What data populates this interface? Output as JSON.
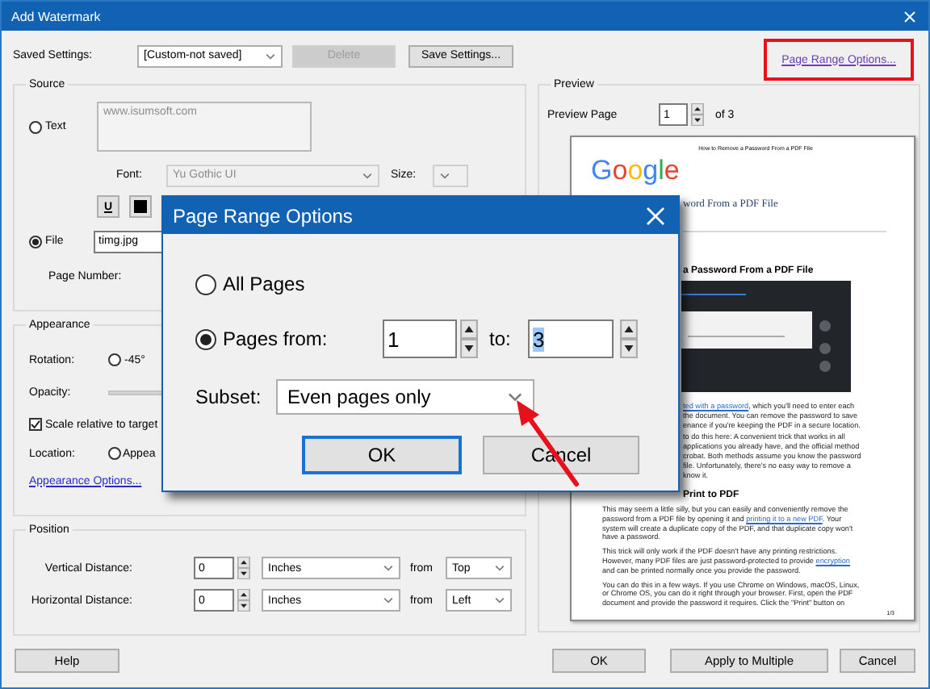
{
  "window": {
    "title": "Add Watermark"
  },
  "saved_settings": {
    "label": "Saved Settings:",
    "value": "[Custom-not saved]",
    "delete_button": {
      "label": "Delete",
      "disabled": true
    },
    "save_button": "Save Settings..."
  },
  "page_range_link": "Page Range Options...",
  "source": {
    "title": "Source",
    "options": [
      {
        "kind": "text",
        "label": "Text",
        "selected": false,
        "value": "www.isumsoft.com"
      },
      {
        "kind": "file",
        "label": "File",
        "selected": true,
        "value": "timg.jpg"
      }
    ],
    "font_label": "Font:",
    "font_value": "Yu Gothic UI",
    "font_disabled": true,
    "size_label": "Size:",
    "underline_button": "U",
    "page_number_label": "Page Number:"
  },
  "appearance": {
    "title": "Appearance",
    "rotation_label": "Rotation:",
    "rotation_option": {
      "label": "-45°",
      "selected": false
    },
    "opacity_label": "Opacity:",
    "scale_checkbox": {
      "label": "Scale relative to target",
      "checked": true
    },
    "location_label": "Location:",
    "location_option": {
      "label": "Appea",
      "selected": false
    },
    "options_link": "Appearance Options..."
  },
  "position": {
    "title": "Position",
    "rows": [
      {
        "label": "Vertical Distance:",
        "value": "0",
        "unit": "Inches",
        "from_label": "from",
        "from": "Top"
      },
      {
        "label": "Horizontal Distance:",
        "value": "0",
        "unit": "Inches",
        "from_label": "from",
        "from": "Left"
      }
    ]
  },
  "preview": {
    "title": "Preview",
    "page_label": "Preview Page",
    "page_value": "1",
    "page_count": "of 3",
    "document": {
      "running_title": "How to Remove a Password From a PDF File",
      "logo": "Google",
      "article_title": "word From a PDF File",
      "section_heading": "a Password From a PDF File",
      "beside_paragraphs": [
        [
          [
            {
              "text": "ted with a password",
              "link": true
            },
            {
              "text": ", which you'll need to enter each",
              "link": false
            }
          ],
          [
            {
              "text": "the document. You can remove the password to save",
              "link": false
            }
          ],
          [
            {
              "text": "enance if you're keeping the PDF in a secure location.",
              "link": false
            }
          ]
        ],
        [
          [
            {
              "text": "to do this here: A convenient trick that works in all",
              "link": false
            }
          ],
          [
            {
              "text": "applications you already have, and the official method",
              "link": false
            }
          ],
          [
            {
              "text": "crobat. Both methods assume you know the password",
              "link": false
            }
          ],
          [
            {
              "text": "file. Unfortunately, there's no easy way to remove a",
              "link": false
            }
          ],
          [
            {
              "text": "know it.",
              "link": false
            }
          ]
        ]
      ],
      "subheading": "Print to PDF",
      "paragraphs": [
        [
          [
            {
              "text": "This may seem a little silly, but you can easily and conveniently remove the",
              "link": false
            }
          ],
          [
            {
              "text": "password from a PDF file by opening it and ",
              "link": false
            },
            {
              "text": "printing it to a new PDF",
              "link": true
            },
            {
              "text": ". Your",
              "link": false
            }
          ],
          [
            {
              "text": "system will create a duplicate copy of the PDF, and that duplicate copy won't",
              "link": false
            }
          ],
          [
            {
              "text": "have a password.",
              "link": false
            }
          ]
        ],
        [
          [
            {
              "text": "This trick will only work if the PDF doesn't have any printing restrictions.",
              "link": false
            }
          ],
          [
            {
              "text": "However, many PDF files are just password-protected to provide ",
              "link": false
            },
            {
              "text": "encryption",
              "link": true
            }
          ],
          [
            {
              "text": "and can be printed normally once you provide the password.",
              "link": false
            }
          ]
        ],
        [
          [
            {
              "text": "You can do this in a few ways. If you use Chrome on Windows, macOS, Linux,",
              "link": false
            }
          ],
          [
            {
              "text": "or Chrome OS, you can do it right through your browser. First, open the PDF",
              "link": false
            }
          ],
          [
            {
              "text": "document and provide the password it requires. Click the \"Print\" button on",
              "link": false
            }
          ]
        ]
      ],
      "page_number": "1/3"
    }
  },
  "buttons": {
    "help": "Help",
    "actions": [
      "OK",
      "Apply to Multiple",
      "Cancel"
    ]
  },
  "dialog": {
    "title": "Page Range Options",
    "options": [
      {
        "kind": "all",
        "label": "All Pages",
        "selected": false
      },
      {
        "kind": "range",
        "label": "Pages from:",
        "selected": true
      }
    ],
    "from_value": "1",
    "to_label": "to:",
    "to_value": "3",
    "to_selected": true,
    "subset_label": "Subset:",
    "subset_value": "Even pages only",
    "buttons": [
      {
        "label": "OK",
        "default": true
      },
      {
        "label": "Cancel",
        "default": false
      }
    ]
  }
}
